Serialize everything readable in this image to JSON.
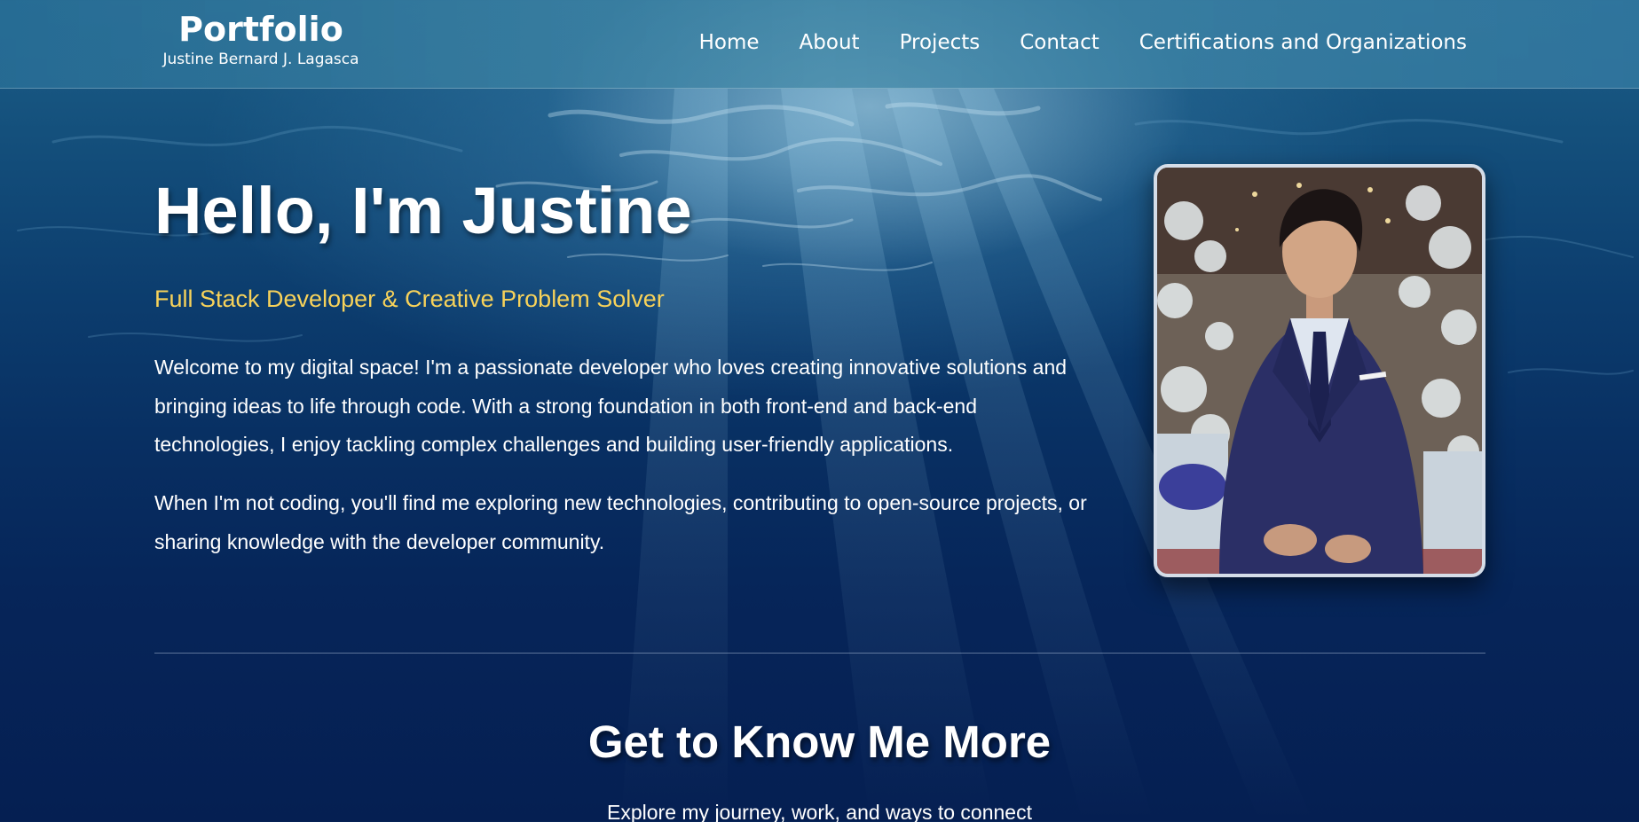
{
  "header": {
    "brand_title": "Portfolio",
    "brand_subtitle": "Justine Bernard J. Lagasca",
    "nav": [
      {
        "label": "Home"
      },
      {
        "label": "About"
      },
      {
        "label": "Projects"
      },
      {
        "label": "Contact"
      },
      {
        "label": "Certifications and Organizations"
      }
    ]
  },
  "hero": {
    "title": "Hello, I'm Justine",
    "subtitle": "Full Stack Developer & Creative Problem Solver",
    "paragraph_1": "Welcome to my digital space! I'm a passionate developer who loves creating innovative solutions and bringing ideas to life through code. With a strong foundation in both front-end and back-end technologies, I enjoy tackling complex challenges and building user-friendly applications.",
    "paragraph_2": "When I'm not coding, you'll find me exploring new technologies, contributing to open-source projects, or sharing knowledge with the developer community."
  },
  "section": {
    "title": "Get to Know Me More",
    "subtitle": "Explore my journey, work, and ways to connect"
  },
  "colors": {
    "accent_subtitle": "#f7d25a",
    "background_top": "#1d5f88",
    "background_bottom": "#051f52"
  }
}
